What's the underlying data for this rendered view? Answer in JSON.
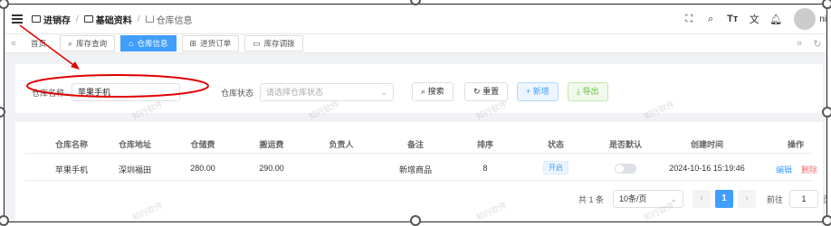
{
  "header": {
    "breadcrumb": [
      "进销存",
      "基础资料",
      "仓库信息"
    ],
    "user": "ni"
  },
  "tabs": [
    {
      "label": "首页",
      "icon": "",
      "active": false
    },
    {
      "label": "库存查询",
      "icon": "search-icon",
      "active": false
    },
    {
      "label": "仓库信息",
      "icon": "home-icon",
      "active": true
    },
    {
      "label": "进货订单",
      "icon": "table-icon",
      "active": false
    },
    {
      "label": "库存调拨",
      "icon": "folder-icon",
      "active": false
    }
  ],
  "search": {
    "name_label": "仓库名称",
    "name_value": "苹果手机",
    "status_label": "仓库状态",
    "status_placeholder": "请选择仓库状态",
    "btn_search": "搜索",
    "btn_reset": "重置",
    "btn_add": "新增",
    "btn_export": "导出"
  },
  "table": {
    "columns": [
      "仓库名称",
      "仓库地址",
      "仓储费",
      "搬运费",
      "负责人",
      "备注",
      "排序",
      "状态",
      "是否默认",
      "创建时间",
      "操作"
    ],
    "rows": [
      {
        "name": "苹果手机",
        "address": "深圳福田",
        "storage_fee": "280.00",
        "handling_fee": "290.00",
        "manager": "",
        "remark": "新增商品",
        "sort": "8",
        "status": "开启",
        "is_default": false,
        "created": "2024-10-16 15:19:46",
        "edit": "编辑",
        "delete": "删除"
      }
    ]
  },
  "pagination": {
    "total": "共 1 条",
    "page_size": "10条/页",
    "current_page": "1",
    "goto_label": "前往",
    "goto_value": "1",
    "page_suffix": "页"
  },
  "watermark": "知行软件",
  "colors": {
    "accent": "#409eff",
    "success": "#67c23a",
    "danger": "#f56c6c",
    "annotation": "#e00000"
  }
}
